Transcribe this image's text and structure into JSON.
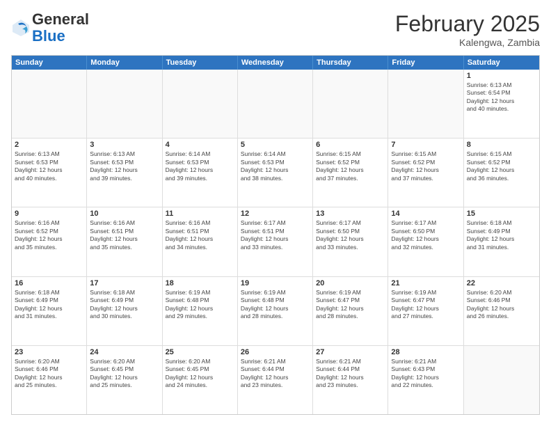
{
  "header": {
    "logo_line1": "General",
    "logo_line2": "Blue",
    "month": "February 2025",
    "location": "Kalengwa, Zambia"
  },
  "weekdays": [
    "Sunday",
    "Monday",
    "Tuesday",
    "Wednesday",
    "Thursday",
    "Friday",
    "Saturday"
  ],
  "rows": [
    [
      {
        "day": "",
        "info": ""
      },
      {
        "day": "",
        "info": ""
      },
      {
        "day": "",
        "info": ""
      },
      {
        "day": "",
        "info": ""
      },
      {
        "day": "",
        "info": ""
      },
      {
        "day": "",
        "info": ""
      },
      {
        "day": "1",
        "info": "Sunrise: 6:13 AM\nSunset: 6:54 PM\nDaylight: 12 hours\nand 40 minutes."
      }
    ],
    [
      {
        "day": "2",
        "info": "Sunrise: 6:13 AM\nSunset: 6:53 PM\nDaylight: 12 hours\nand 40 minutes."
      },
      {
        "day": "3",
        "info": "Sunrise: 6:13 AM\nSunset: 6:53 PM\nDaylight: 12 hours\nand 39 minutes."
      },
      {
        "day": "4",
        "info": "Sunrise: 6:14 AM\nSunset: 6:53 PM\nDaylight: 12 hours\nand 39 minutes."
      },
      {
        "day": "5",
        "info": "Sunrise: 6:14 AM\nSunset: 6:53 PM\nDaylight: 12 hours\nand 38 minutes."
      },
      {
        "day": "6",
        "info": "Sunrise: 6:15 AM\nSunset: 6:52 PM\nDaylight: 12 hours\nand 37 minutes."
      },
      {
        "day": "7",
        "info": "Sunrise: 6:15 AM\nSunset: 6:52 PM\nDaylight: 12 hours\nand 37 minutes."
      },
      {
        "day": "8",
        "info": "Sunrise: 6:15 AM\nSunset: 6:52 PM\nDaylight: 12 hours\nand 36 minutes."
      }
    ],
    [
      {
        "day": "9",
        "info": "Sunrise: 6:16 AM\nSunset: 6:52 PM\nDaylight: 12 hours\nand 35 minutes."
      },
      {
        "day": "10",
        "info": "Sunrise: 6:16 AM\nSunset: 6:51 PM\nDaylight: 12 hours\nand 35 minutes."
      },
      {
        "day": "11",
        "info": "Sunrise: 6:16 AM\nSunset: 6:51 PM\nDaylight: 12 hours\nand 34 minutes."
      },
      {
        "day": "12",
        "info": "Sunrise: 6:17 AM\nSunset: 6:51 PM\nDaylight: 12 hours\nand 33 minutes."
      },
      {
        "day": "13",
        "info": "Sunrise: 6:17 AM\nSunset: 6:50 PM\nDaylight: 12 hours\nand 33 minutes."
      },
      {
        "day": "14",
        "info": "Sunrise: 6:17 AM\nSunset: 6:50 PM\nDaylight: 12 hours\nand 32 minutes."
      },
      {
        "day": "15",
        "info": "Sunrise: 6:18 AM\nSunset: 6:49 PM\nDaylight: 12 hours\nand 31 minutes."
      }
    ],
    [
      {
        "day": "16",
        "info": "Sunrise: 6:18 AM\nSunset: 6:49 PM\nDaylight: 12 hours\nand 31 minutes."
      },
      {
        "day": "17",
        "info": "Sunrise: 6:18 AM\nSunset: 6:49 PM\nDaylight: 12 hours\nand 30 minutes."
      },
      {
        "day": "18",
        "info": "Sunrise: 6:19 AM\nSunset: 6:48 PM\nDaylight: 12 hours\nand 29 minutes."
      },
      {
        "day": "19",
        "info": "Sunrise: 6:19 AM\nSunset: 6:48 PM\nDaylight: 12 hours\nand 28 minutes."
      },
      {
        "day": "20",
        "info": "Sunrise: 6:19 AM\nSunset: 6:47 PM\nDaylight: 12 hours\nand 28 minutes."
      },
      {
        "day": "21",
        "info": "Sunrise: 6:19 AM\nSunset: 6:47 PM\nDaylight: 12 hours\nand 27 minutes."
      },
      {
        "day": "22",
        "info": "Sunrise: 6:20 AM\nSunset: 6:46 PM\nDaylight: 12 hours\nand 26 minutes."
      }
    ],
    [
      {
        "day": "23",
        "info": "Sunrise: 6:20 AM\nSunset: 6:46 PM\nDaylight: 12 hours\nand 25 minutes."
      },
      {
        "day": "24",
        "info": "Sunrise: 6:20 AM\nSunset: 6:45 PM\nDaylight: 12 hours\nand 25 minutes."
      },
      {
        "day": "25",
        "info": "Sunrise: 6:20 AM\nSunset: 6:45 PM\nDaylight: 12 hours\nand 24 minutes."
      },
      {
        "day": "26",
        "info": "Sunrise: 6:21 AM\nSunset: 6:44 PM\nDaylight: 12 hours\nand 23 minutes."
      },
      {
        "day": "27",
        "info": "Sunrise: 6:21 AM\nSunset: 6:44 PM\nDaylight: 12 hours\nand 23 minutes."
      },
      {
        "day": "28",
        "info": "Sunrise: 6:21 AM\nSunset: 6:43 PM\nDaylight: 12 hours\nand 22 minutes."
      },
      {
        "day": "",
        "info": ""
      }
    ]
  ]
}
